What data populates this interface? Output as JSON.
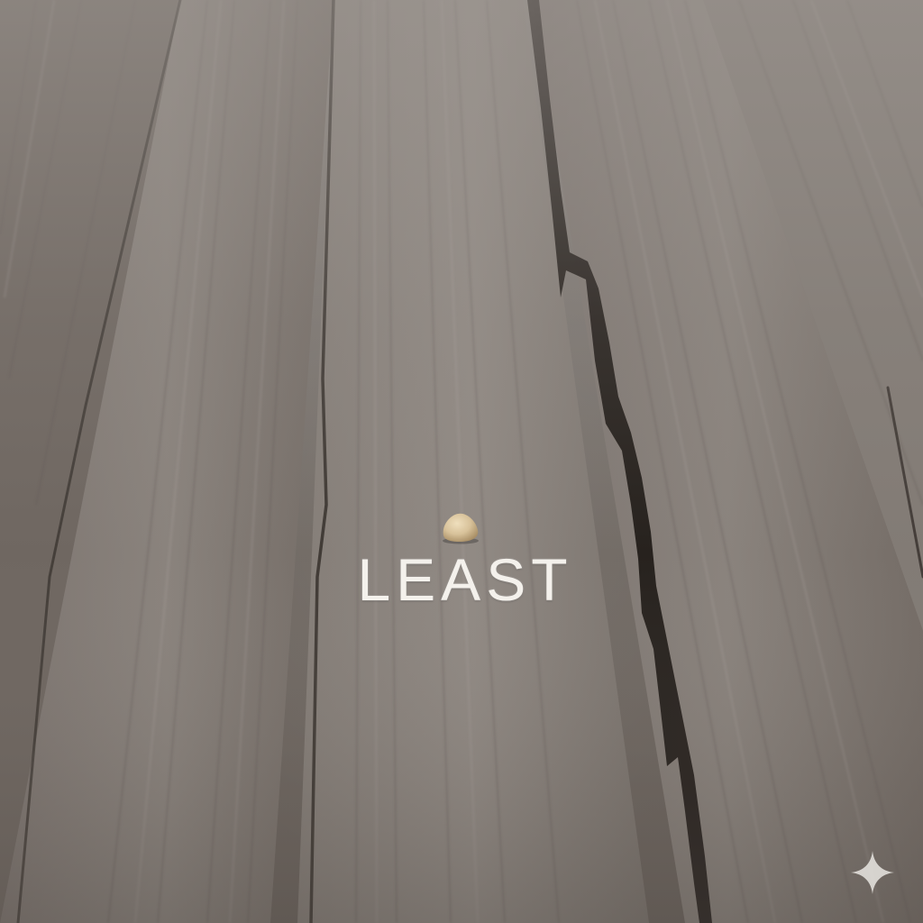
{
  "overlay_text": "LEAST",
  "icons": {
    "pebble": "pebble-object",
    "corner_mark": "sparkle-icon"
  },
  "colors": {
    "wood_base": "#7a746f",
    "crack": "#1f1a17",
    "text": "#f4f1ec",
    "pebble": "#d8c29a"
  }
}
